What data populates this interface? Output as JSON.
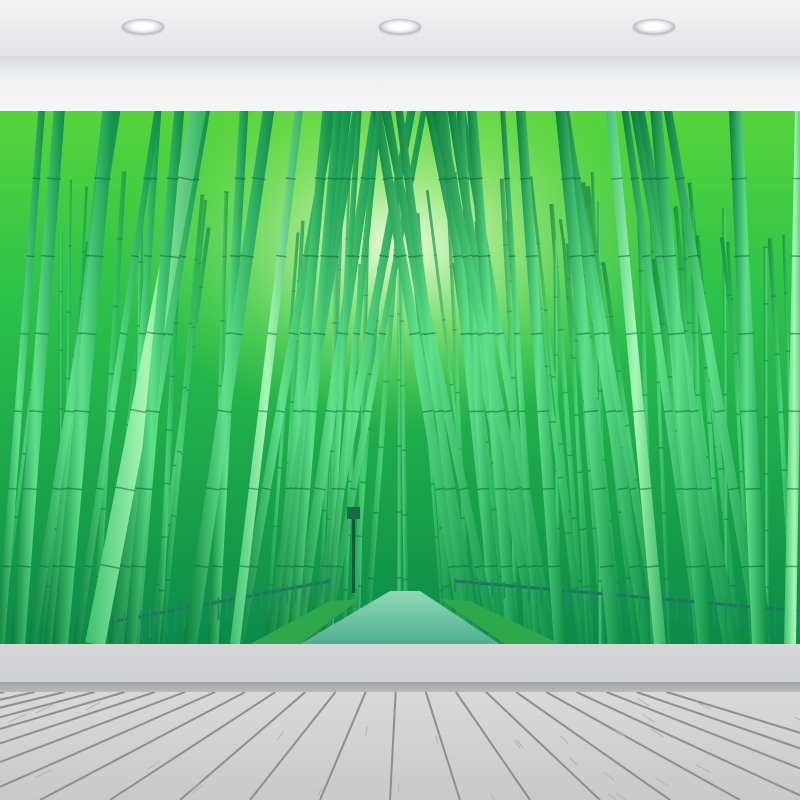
{
  "scene": {
    "subject": "bamboo-forest-wall-mural",
    "colors": {
      "bamboo_light": "#8ef29a",
      "bamboo_mid": "#22c45a",
      "bamboo_dark": "#0a7a3a",
      "canopy": "#7fe04a",
      "sky_glow": "#f4ffe6",
      "path": "#5fbfa0",
      "fence": "#1c7a5a",
      "wall": "#e9eaec",
      "floor_wood": "#c8c8c8"
    }
  }
}
